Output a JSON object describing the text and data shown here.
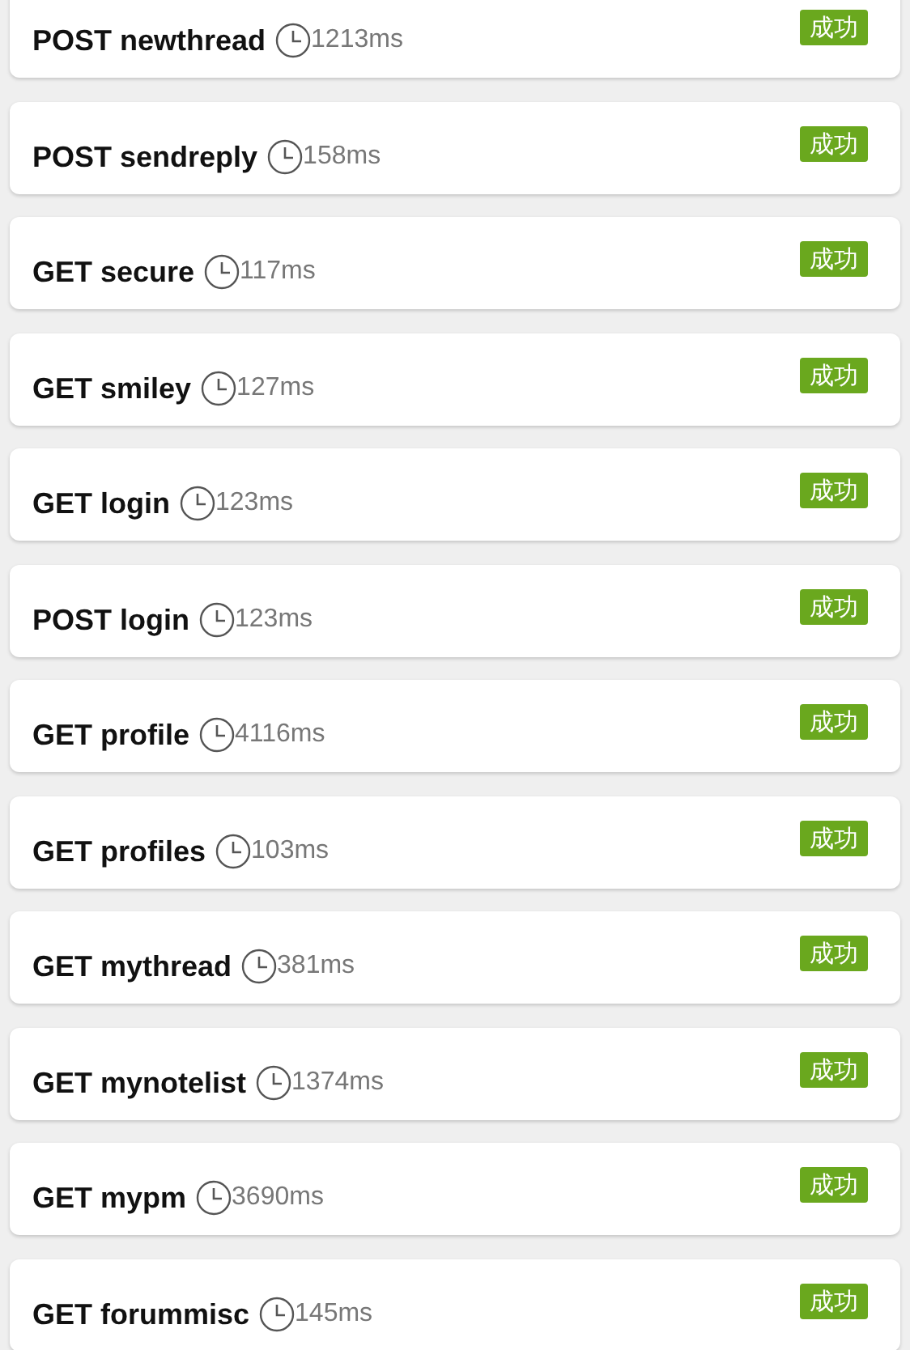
{
  "requests": [
    {
      "method": "POST",
      "name": "newthread",
      "time": "1213ms",
      "status": "成功"
    },
    {
      "method": "POST",
      "name": "sendreply",
      "time": "158ms",
      "status": "成功"
    },
    {
      "method": "GET",
      "name": "secure",
      "time": "117ms",
      "status": "成功"
    },
    {
      "method": "GET",
      "name": "smiley",
      "time": "127ms",
      "status": "成功"
    },
    {
      "method": "GET",
      "name": "login",
      "time": "123ms",
      "status": "成功"
    },
    {
      "method": "POST",
      "name": "login",
      "time": "123ms",
      "status": "成功"
    },
    {
      "method": "GET",
      "name": "profile",
      "time": "4116ms",
      "status": "成功"
    },
    {
      "method": "GET",
      "name": "profiles",
      "time": "103ms",
      "status": "成功"
    },
    {
      "method": "GET",
      "name": "mythread",
      "time": "381ms",
      "status": "成功"
    },
    {
      "method": "GET",
      "name": "mynotelist",
      "time": "1374ms",
      "status": "成功"
    },
    {
      "method": "GET",
      "name": "mypm",
      "time": "3690ms",
      "status": "成功"
    },
    {
      "method": "GET",
      "name": "forummisc",
      "time": "145ms",
      "status": "成功"
    }
  ]
}
